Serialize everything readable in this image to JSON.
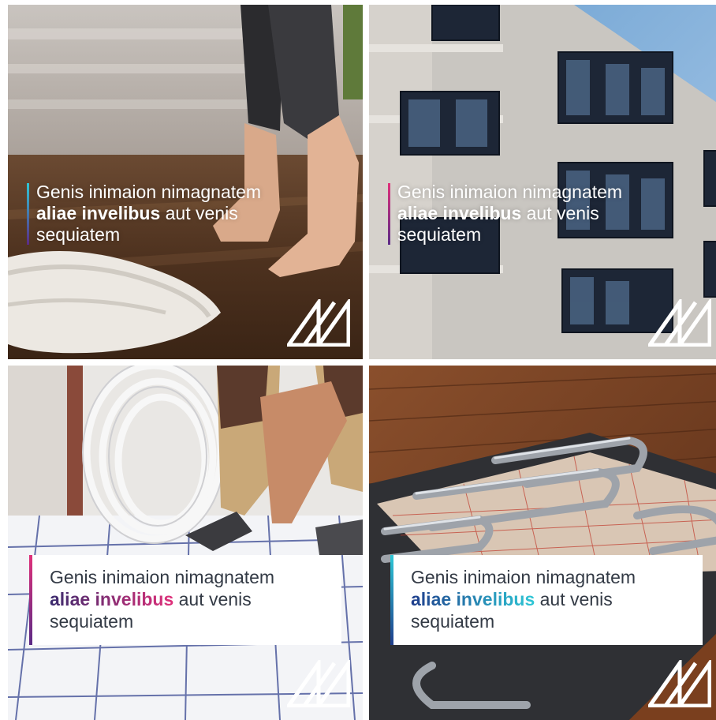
{
  "tiles": [
    {
      "style": "overlay",
      "scene": "bare feet walking on warm wooden floor next to a white shag rug",
      "accent_gradient": [
        "#2ec7d6",
        "#5b2a86"
      ],
      "line1": "Genis inimaion nimagnatem",
      "bold": "aliae invelibus",
      "rest": " aut venis",
      "line3": "sequiatem",
      "logo_icon": "brand-logo-icon"
    },
    {
      "style": "overlay",
      "scene": "modern apartment building facade with dark framed windows and blue sky",
      "accent_gradient": [
        "#e0307a",
        "#5b2a86"
      ],
      "line1": "Genis inimaion nimagnatem",
      "bold": "aliae invelibus",
      "rest": " aut venis",
      "line3": "sequiatem",
      "logo_icon": "brand-logo-icon"
    },
    {
      "style": "card",
      "scene": "installer laying white underfloor heating pipe coil on insulation grid",
      "accent_gradient": [
        "#e0307a",
        "#5b2a86"
      ],
      "highlight_colors": [
        "#3a2b6e",
        "#e0307a"
      ],
      "line1": "Genis inimaion nimagnatem",
      "bold": "aliae invelibus",
      "rest": " aut venis",
      "line3": "sequiatem",
      "logo_icon": "brand-logo-icon"
    },
    {
      "style": "card",
      "scene": "cutaway of wooden floor showing metal underfloor heating pipes on red grid",
      "accent_gradient": [
        "#2ec7d6",
        "#1f3e8c"
      ],
      "highlight_colors": [
        "#1f3e8c",
        "#2ec7d6"
      ],
      "line1": "Genis inimaion nimagnatem",
      "bold": "aliae invelibus",
      "rest": " aut venis",
      "line3": "sequiatem",
      "logo_icon": "brand-logo-icon"
    }
  ]
}
